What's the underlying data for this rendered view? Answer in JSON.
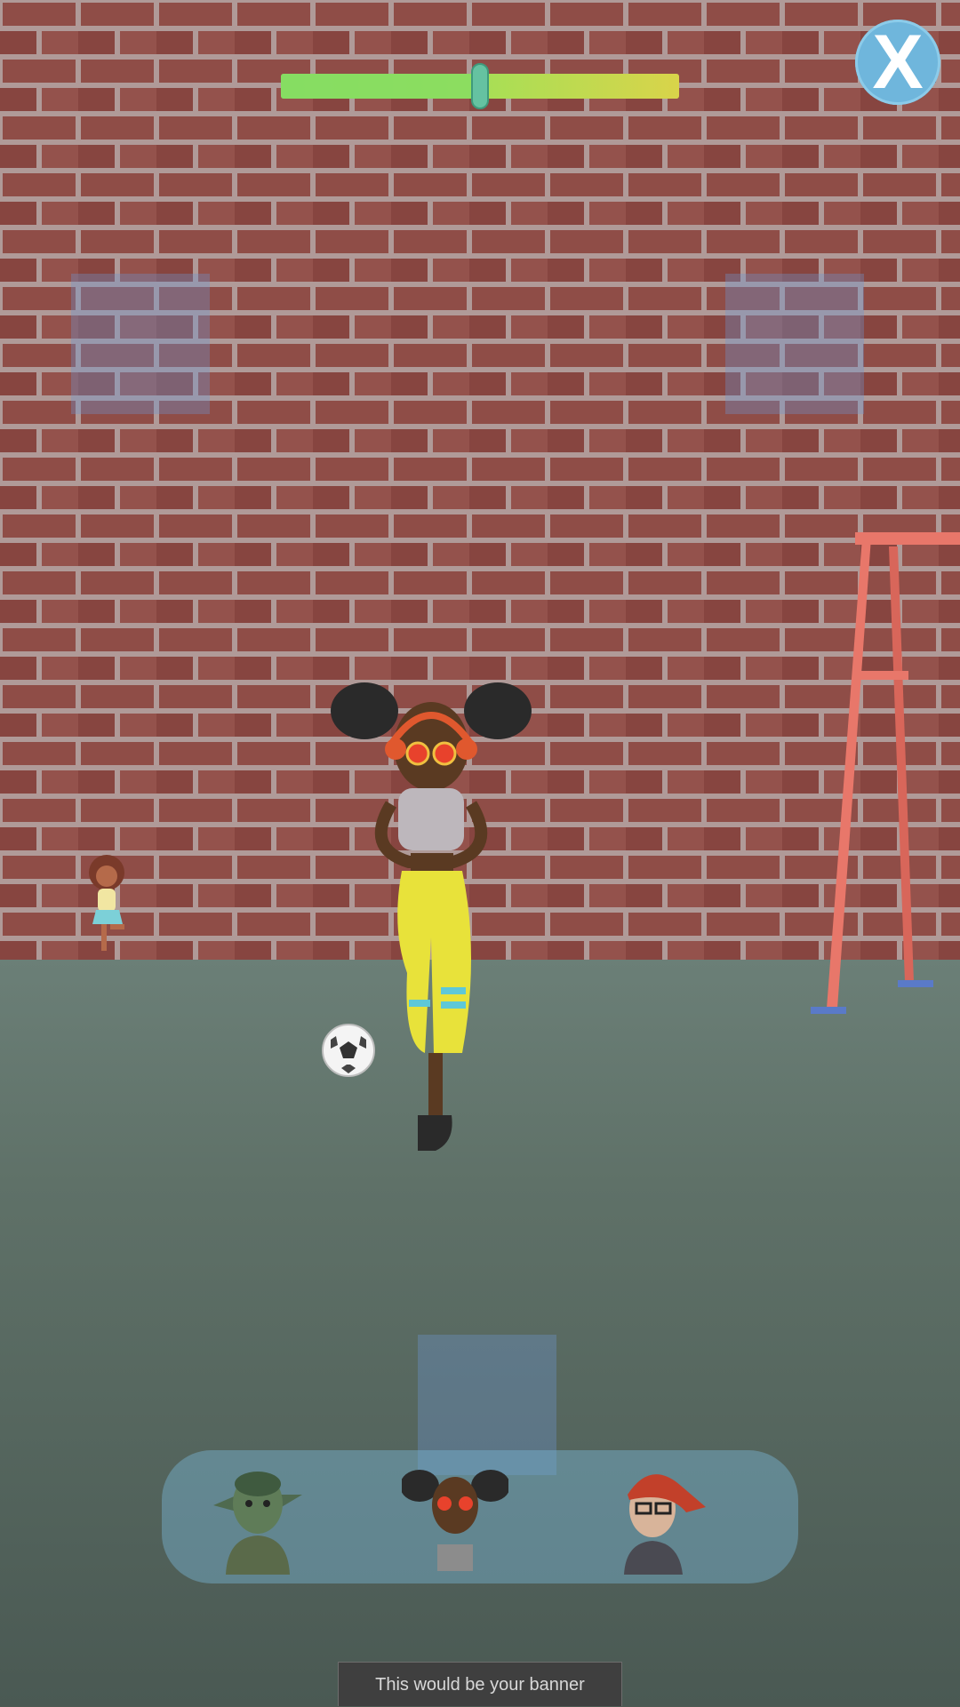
{
  "hud": {
    "close_label": "X",
    "balance_slider": {
      "value": 0.5,
      "accent_left": "#90e060",
      "accent_right": "#d9d44a",
      "handle": "#65c2a1"
    }
  },
  "character_selector": {
    "avatars": [
      {
        "name": "goblin-avatar"
      },
      {
        "name": "girl-headphones-avatar"
      },
      {
        "name": "boy-cap-avatar"
      }
    ]
  },
  "banner": {
    "text": "This would be your banner"
  },
  "colors": {
    "wall": "#8a4a44",
    "ground": "#5f7168",
    "selector": "#78b4d2",
    "close_button": "#6fb6dc"
  }
}
